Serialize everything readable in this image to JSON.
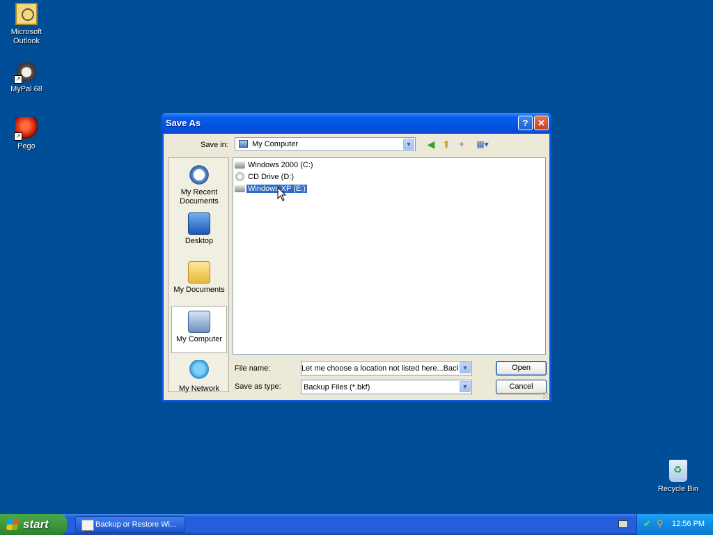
{
  "desktop": {
    "icons": [
      {
        "label": "Microsoft Outlook",
        "icon": "outlook-icon"
      },
      {
        "label": "MyPal 68",
        "icon": "mypal-icon"
      },
      {
        "label": "Pego",
        "icon": "pego-icon"
      },
      {
        "label": "Recycle Bin",
        "icon": "recycle-bin-icon"
      }
    ]
  },
  "dialog": {
    "title": "Save As",
    "help": "?",
    "close": "✕",
    "save_in_label": "Save in:",
    "save_in_value": "My Computer",
    "places": [
      {
        "label": "My Recent Documents"
      },
      {
        "label": "Desktop"
      },
      {
        "label": "My Documents"
      },
      {
        "label": "My Computer"
      },
      {
        "label": "My Network"
      }
    ],
    "files": [
      {
        "label": "Windows 2000 (C:)"
      },
      {
        "label": "CD Drive (D:)"
      },
      {
        "label": "Windows XP (E:)"
      }
    ],
    "file_name_label": "File name:",
    "file_name_value": "Let me choose a location not listed here...Backup",
    "save_type_label": "Save as type:",
    "save_type_value": "Backup Files (*.bkf)",
    "open_label": "Open",
    "cancel_label": "Cancel"
  },
  "taskbar": {
    "start_label": "start",
    "task_label": "Backup or Restore Wi...",
    "clock": "12:56 PM"
  }
}
